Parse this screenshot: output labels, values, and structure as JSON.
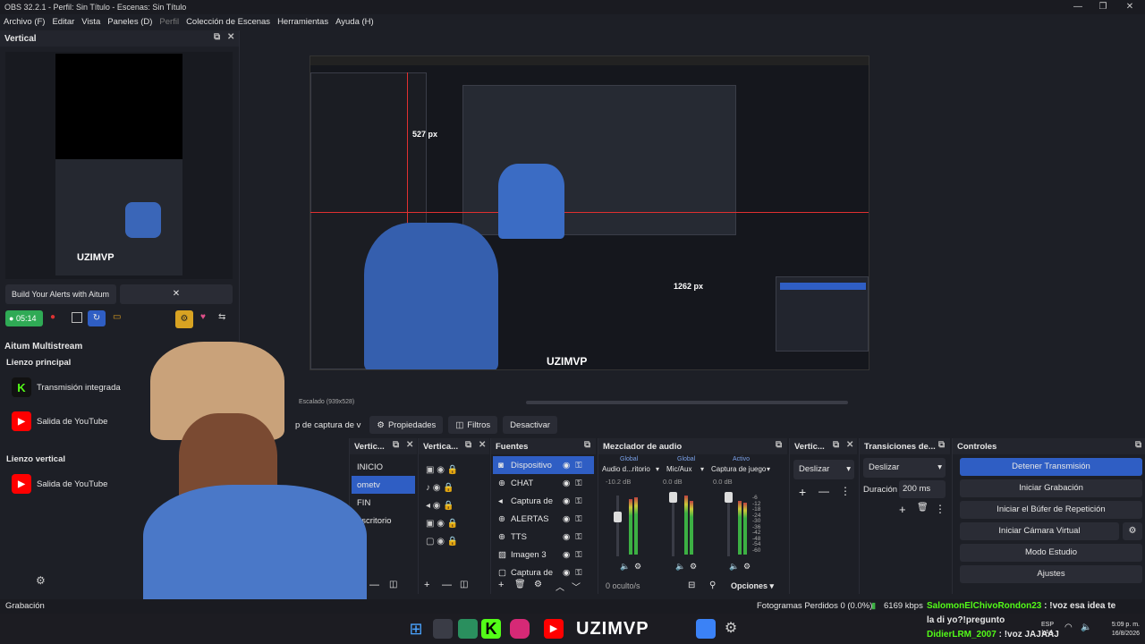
{
  "window": {
    "title": "OBS 32.2.1 - Perfil: Sin Título - Escenas: Sin Título"
  },
  "menu": [
    "Archivo (F)",
    "Editar",
    "Vista",
    "Paneles (D)",
    "Perfil",
    "Colección de Escenas",
    "Herramientas",
    "Ayuda (H)"
  ],
  "vertical_dock": {
    "title": "Vertical",
    "alert_button": "Build Your Alerts with Aitum",
    "timer": "05:14"
  },
  "multistream": {
    "title": "Aitum Multistream",
    "main_canvas_label": "Lienzo principal",
    "main_outputs": [
      "Transmisión integrada",
      "Salida de YouTube"
    ],
    "vertical_canvas_label": "Lienzo vertical",
    "vertical_outputs": [
      "Salida de YouTube"
    ]
  },
  "preview": {
    "scaled_label": "Escalado (939x528)",
    "guide_vertical": "527 px",
    "guide_horizontal": "1262 px",
    "overlay_logo": "UZIMVP"
  },
  "source_toolbar": {
    "source_name": "p de captura de v",
    "properties": "Propiedades",
    "filters": "Filtros",
    "deactivate": "Desactivar"
  },
  "scenes_vertical": {
    "title": "Vertic...",
    "items": [
      "INICIO",
      "ometv",
      "FIN",
      "escritorio"
    ],
    "selected": 1
  },
  "vertical_sources": {
    "title": "Vertica..."
  },
  "sources": {
    "title": "Fuentes",
    "items": [
      "Dispositivo",
      "CHAT",
      "Captura de",
      "ALERTAS",
      "TTS",
      "Imagen 3",
      "Captura de"
    ]
  },
  "mixer": {
    "title": "Mezclador de audio",
    "channels": [
      {
        "tag": "Global",
        "name": "Audio d...ritorio",
        "db": "-10.2 dB"
      },
      {
        "tag": "Global",
        "name": "Mic/Aux",
        "db": "0.0 dB"
      },
      {
        "tag": "Activo",
        "name": "Captura de juego",
        "db": "0.0 dB"
      }
    ],
    "scale": [
      "-6",
      "-12",
      "-18",
      "-24",
      "-30",
      "-36",
      "-42",
      "-48",
      "-54",
      "-60"
    ],
    "hidden": "0 oculto/s",
    "options": "Opciones"
  },
  "vertical_transition": {
    "title": "Vertic...",
    "value": "Deslizar"
  },
  "transitions": {
    "title": "Transiciones de...",
    "value": "Deslizar",
    "duration_label": "Duración",
    "duration_value": "200 ms"
  },
  "controls": {
    "title": "Controles",
    "buttons": [
      "Detener Transmisión",
      "Iniciar Grabación",
      "Iniciar el Búfer de Repetición",
      "Iniciar Cámara Virtual",
      "Modo Estudio",
      "Ajustes"
    ]
  },
  "statusbar": {
    "recording": "Grabación",
    "dropped_frames": "Fotogramas Perdidos 0 (0.0%)",
    "bitrate": "6169 kbps",
    "chat_line1_user": "SalomonElChivoRondon23",
    "chat_line1_msg": ": !voz esa idea te",
    "chat_line1_cont": "la di yo?!pregunto",
    "chat_line2_user": "DidierLRM_2007",
    "chat_line2_msg": ": !voz JAJAAJ"
  },
  "taskbar": {
    "brand": "UZIMVP",
    "lang": "ESP",
    "lang_sub": "LAA",
    "time": "5:09 p. m.",
    "date": "16/8/2026"
  },
  "colors": {
    "accent": "#2f5ec4",
    "kick": "#53fc18",
    "youtube": "#ff0000"
  }
}
